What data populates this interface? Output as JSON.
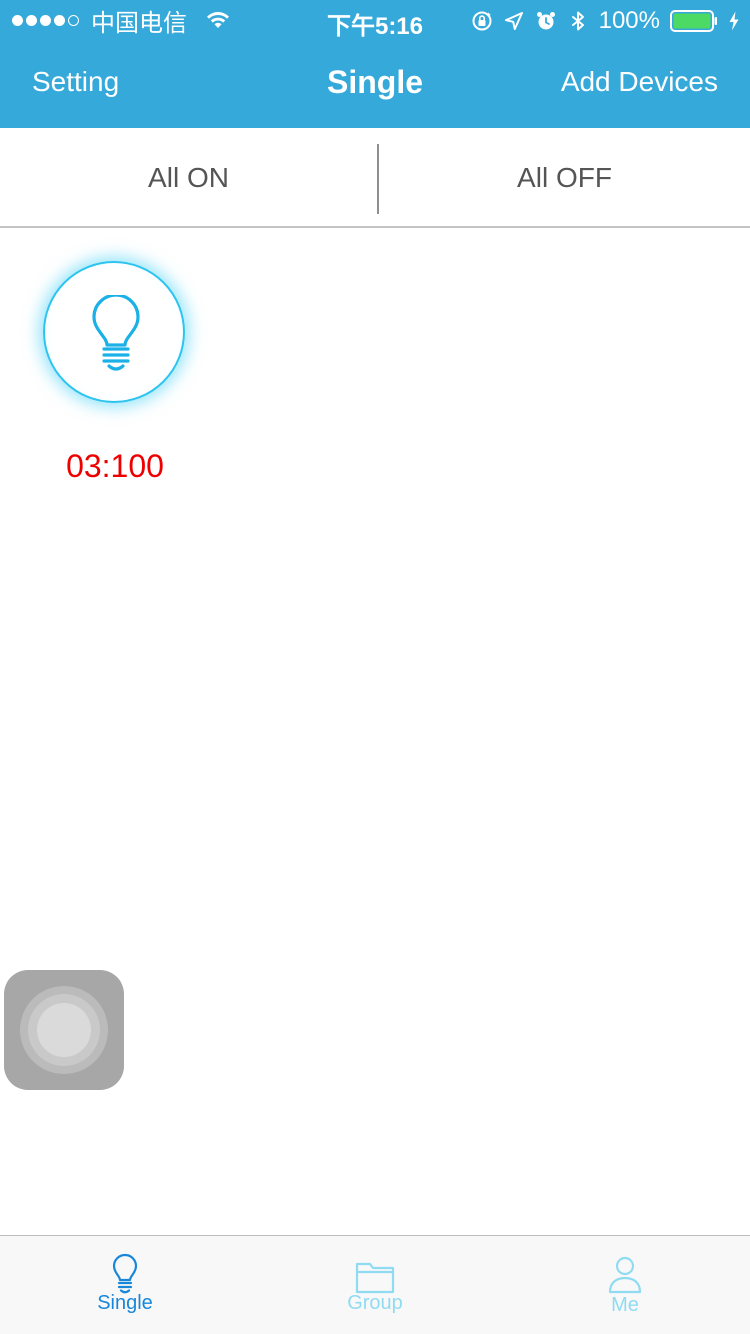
{
  "status_bar": {
    "carrier": "中国电信",
    "time": "下午5:16",
    "battery_percent": "100%",
    "signal_strength": 4,
    "signal_max": 5,
    "icons": [
      "wifi-icon",
      "orientation-lock-icon",
      "location-arrow-icon",
      "alarm-icon",
      "bluetooth-icon",
      "battery-icon",
      "charging-icon"
    ]
  },
  "nav": {
    "left_label": "Setting",
    "title": "Single",
    "right_label": "Add Devices"
  },
  "controls": {
    "all_on_label": "All ON",
    "all_off_label": "All OFF"
  },
  "devices": [
    {
      "label": "03:100",
      "icon": "lightbulb-icon",
      "label_color": "#ee0000"
    }
  ],
  "tab_bar": {
    "tabs": [
      {
        "label": "Single",
        "icon": "lightbulb-icon",
        "active": true
      },
      {
        "label": "Group",
        "icon": "folder-icon",
        "active": false
      },
      {
        "label": "Me",
        "icon": "person-icon",
        "active": false
      }
    ]
  },
  "colors": {
    "header_blue": "#35a9da",
    "device_ring": "#2cc4ee",
    "tab_active": "#1887d9",
    "tab_inactive": "#8fdcf2",
    "device_label_red": "#ee0000"
  }
}
